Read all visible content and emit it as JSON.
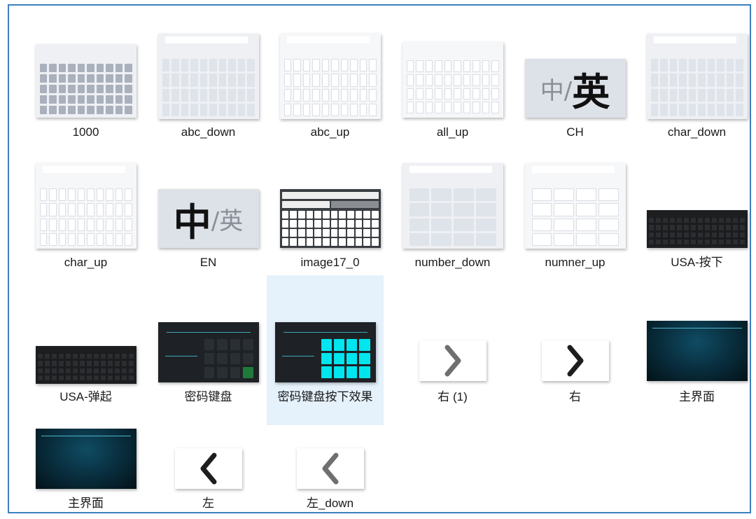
{
  "window": {
    "title": ""
  },
  "items": [
    {
      "label": "1000",
      "icon": "keyboard-gray-thumbnail"
    },
    {
      "label": "abc_down",
      "icon": "keyboard-light-thumbnail"
    },
    {
      "label": "abc_up",
      "icon": "keyboard-white-thumbnail"
    },
    {
      "label": "all_up",
      "icon": "keyboard-white-thumbnail"
    },
    {
      "label": "CH",
      "icon": "language-toggle-thumbnail",
      "big": "英",
      "small": "中/"
    },
    {
      "label": "char_down",
      "icon": "keyboard-light-thumbnail"
    },
    {
      "label": "char_up",
      "icon": "keyboard-white-thumbnail"
    },
    {
      "label": "EN",
      "icon": "language-toggle-thumbnail",
      "big": "中",
      "small": "/英"
    },
    {
      "label": "image17_0",
      "icon": "keyboard-dark-thumbnail"
    },
    {
      "label": "number_down",
      "icon": "numpad-light-thumbnail"
    },
    {
      "label": "numner_up",
      "icon": "numpad-white-thumbnail"
    },
    {
      "label": "USA-按下",
      "icon": "keyboard-black-thumbnail"
    },
    {
      "label": "USA-弹起",
      "icon": "keyboard-black-thumbnail"
    },
    {
      "label": "密码键盘",
      "icon": "password-keypad-thumbnail"
    },
    {
      "label": "密码键盘按下效果",
      "icon": "password-keypad-pressed-thumbnail",
      "selected": true
    },
    {
      "label": "右 (1)",
      "icon": "chevron-right-thumbnail"
    },
    {
      "label": "右",
      "icon": "chevron-right-thumbnail"
    },
    {
      "label": "主界面",
      "icon": "main-screen-thumbnail"
    },
    {
      "label": "主界面",
      "icon": "main-screen-thumbnail"
    },
    {
      "label": "左",
      "icon": "chevron-left-thumbnail"
    },
    {
      "label": "左_down",
      "icon": "chevron-left-thumbnail"
    }
  ],
  "colors": {
    "border": "#3b7fbf",
    "selection": "#e5f1fb",
    "cyan_key": "#00e5ee"
  }
}
